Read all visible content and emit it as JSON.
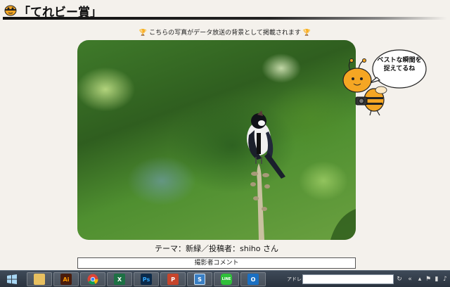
{
  "header": {
    "title": "「てれビー賞」"
  },
  "caption": {
    "text": "こちらの写真がデータ放送の背景として掲載されます"
  },
  "mascot": {
    "bubble_line1": "ベストな瞬間を",
    "bubble_line2": "捉えてるね"
  },
  "photo": {
    "caption": "テーマ：新緑／投稿者：shiho さん"
  },
  "comment": {
    "label": "撮影者コメント"
  },
  "taskbar": {
    "apps": [
      {
        "name": "file-explorer",
        "label": ""
      },
      {
        "name": "illustrator",
        "label": "Ai"
      },
      {
        "name": "chrome",
        "label": ""
      },
      {
        "name": "excel",
        "label": "X"
      },
      {
        "name": "photoshop",
        "label": "Ps"
      },
      {
        "name": "powerpoint",
        "label": "P"
      },
      {
        "name": "app-s",
        "label": "S"
      },
      {
        "name": "line",
        "label": "LINE"
      },
      {
        "name": "outlook",
        "label": "O"
      }
    ],
    "address_label": "アドレス",
    "address_value": ""
  },
  "colors": {
    "background": "#f4f1ec",
    "taskbar": "#2f3945",
    "mascot_body": "#f5a623"
  }
}
